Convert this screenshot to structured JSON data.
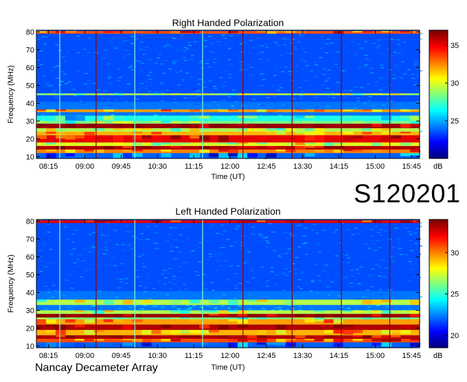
{
  "dataset_id": "S120201",
  "credit": "Nancay Decameter Array",
  "colors": {
    "background": "#ffffff",
    "colormap": "jet",
    "rfi_line_cyan": "#7fffd4",
    "rfi_line_dark_red": "#8b0000"
  },
  "chart_data": [
    {
      "type": "heatmap",
      "title": "Right Handed Polarization",
      "xlabel": "Time (UT)",
      "ylabel": "Frequency (MHz)",
      "x_ticks": [
        "08:15",
        "09:00",
        "09:45",
        "10:30",
        "11:15",
        "12:00",
        "12:45",
        "13:30",
        "14:15",
        "15:00",
        "15:45"
      ],
      "y_ticks": [
        10,
        20,
        30,
        40,
        50,
        60,
        70,
        80
      ],
      "xlim": [
        "08:00",
        "15:55"
      ],
      "ylim": [
        9,
        81
      ],
      "colorbar": {
        "label": "dB",
        "ticks": [
          25,
          30,
          35
        ],
        "range": [
          20,
          37
        ]
      },
      "bands": [
        {
          "f": [
            9,
            12
          ],
          "level": 0.22
        },
        {
          "f": [
            12,
            14
          ],
          "level": 0.75
        },
        {
          "f": [
            14,
            16
          ],
          "level": 0.95
        },
        {
          "f": [
            16,
            18
          ],
          "level": 0.6
        },
        {
          "f": [
            18,
            22
          ],
          "level": 0.9
        },
        {
          "f": [
            22,
            24
          ],
          "level": 0.7
        },
        {
          "f": [
            24,
            26
          ],
          "level": 0.55
        },
        {
          "f": [
            26,
            28.5
          ],
          "level": 0.97
        },
        {
          "f": [
            28.5,
            30
          ],
          "level": 0.5
        },
        {
          "f": [
            30,
            33
          ],
          "level": 0.4
        },
        {
          "f": [
            35,
            36.5
          ],
          "level": 0.72
        },
        {
          "f": [
            44.5,
            45.5
          ],
          "level": 0.55
        },
        {
          "f": [
            79,
            80.5
          ],
          "level": 0.8
        }
      ],
      "vertical_lines": [
        {
          "t": "08:29",
          "kind": "cyan"
        },
        {
          "t": "09:14",
          "kind": "dark-red"
        },
        {
          "t": "10:02",
          "kind": "cyan"
        },
        {
          "t": "11:26",
          "kind": "cyan"
        },
        {
          "t": "12:16",
          "kind": "dark-red"
        },
        {
          "t": "13:17",
          "kind": "dark-red"
        },
        {
          "t": "14:18",
          "kind": "dark-red"
        },
        {
          "t": "15:18",
          "kind": "dark-red"
        }
      ]
    },
    {
      "type": "heatmap",
      "title": "Left Handed Polarization",
      "xlabel": "Time (UT)",
      "ylabel": "Frequency (MHz)",
      "x_ticks": [
        "08:15",
        "09:00",
        "09:45",
        "10:30",
        "11:15",
        "12:00",
        "12:45",
        "13:30",
        "14:15",
        "15:00",
        "15:45"
      ],
      "y_ticks": [
        10,
        20,
        30,
        40,
        50,
        60,
        70,
        80
      ],
      "xlim": [
        "08:00",
        "15:55"
      ],
      "ylim": [
        9,
        81
      ],
      "colorbar": {
        "label": "dB",
        "ticks": [
          20,
          25,
          30
        ],
        "range": [
          18.5,
          34
        ]
      },
      "bands": [
        {
          "f": [
            9,
            12
          ],
          "level": 0.22
        },
        {
          "f": [
            12,
            14
          ],
          "level": 0.8
        },
        {
          "f": [
            14,
            16
          ],
          "level": 0.95
        },
        {
          "f": [
            16,
            19
          ],
          "level": 0.7
        },
        {
          "f": [
            19,
            22
          ],
          "level": 0.95
        },
        {
          "f": [
            22,
            25
          ],
          "level": 0.72
        },
        {
          "f": [
            25,
            26
          ],
          "level": 0.5
        },
        {
          "f": [
            26,
            28
          ],
          "level": 0.97
        },
        {
          "f": [
            28,
            30
          ],
          "level": 0.55
        },
        {
          "f": [
            33,
            36
          ],
          "level": 0.55
        },
        {
          "f": [
            79,
            80.5
          ],
          "level": 0.9
        }
      ],
      "vertical_lines": [
        {
          "t": "08:29",
          "kind": "cyan"
        },
        {
          "t": "09:14",
          "kind": "dark-red"
        },
        {
          "t": "10:02",
          "kind": "cyan"
        },
        {
          "t": "11:26",
          "kind": "cyan"
        },
        {
          "t": "12:16",
          "kind": "dark-red"
        },
        {
          "t": "13:17",
          "kind": "dark-red"
        },
        {
          "t": "14:18",
          "kind": "dark-red"
        },
        {
          "t": "15:18",
          "kind": "dark-red"
        }
      ]
    }
  ]
}
